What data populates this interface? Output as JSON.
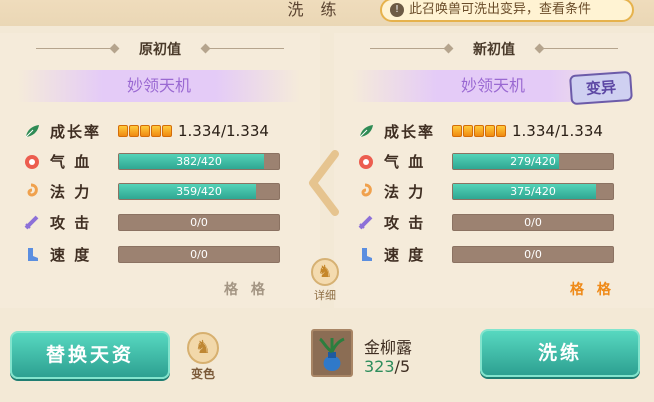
{
  "header": {
    "title": "洗 练",
    "hint": "此召唤兽可洗出变异，查看条件"
  },
  "left_panel": {
    "title": "原初值",
    "pet_name": "妙领天机",
    "growth_label": "成长率",
    "growth_value": "1.334/1.334",
    "stats": [
      {
        "label": "气 血",
        "value": "382/420",
        "fill": 0.909,
        "icon": "blood-icon"
      },
      {
        "label": "法 力",
        "value": "359/420",
        "fill": 0.855,
        "icon": "mana-icon"
      },
      {
        "label": "攻 击",
        "value": "0/0",
        "fill": 0,
        "icon": "attack-icon"
      },
      {
        "label": "速 度",
        "value": "0/0",
        "fill": 0,
        "icon": "speed-icon"
      }
    ],
    "grade": "格 格"
  },
  "right_panel": {
    "title": "新初值",
    "pet_name": "妙领天机",
    "badge": "变异",
    "growth_label": "成长率",
    "growth_value": "1.334/1.334",
    "stats": [
      {
        "label": "气 血",
        "value": "279/420",
        "fill": 0.664,
        "icon": "blood-icon"
      },
      {
        "label": "法 力",
        "value": "375/420",
        "fill": 0.893,
        "icon": "mana-icon"
      },
      {
        "label": "攻 击",
        "value": "0/0",
        "fill": 0,
        "icon": "attack-icon"
      },
      {
        "label": "速 度",
        "value": "0/0",
        "fill": 0,
        "icon": "speed-icon"
      }
    ],
    "grade": "格 格"
  },
  "detail_button": {
    "label": "详细"
  },
  "bottom": {
    "replace_button": "替换天资",
    "color_button": "变色",
    "item_name": "金柳露",
    "item_have": "323",
    "item_need": "/5",
    "wash_button": "洗练"
  }
}
